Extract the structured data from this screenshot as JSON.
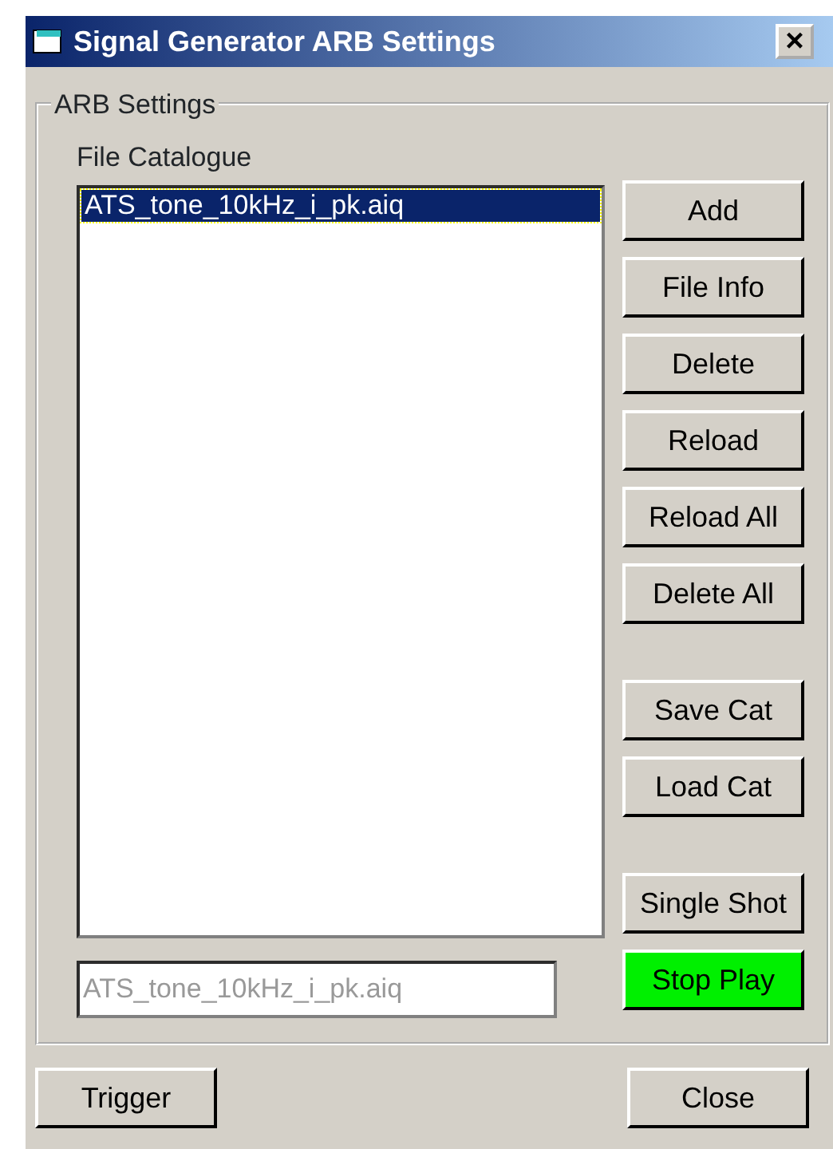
{
  "window": {
    "title": "Signal Generator ARB Settings",
    "close": "×"
  },
  "group": {
    "title": "ARB Settings",
    "list_label": "File Catalogue",
    "files": [
      {
        "name": "ATS_tone_10kHz_i_pk.aiq",
        "selected": true
      }
    ],
    "button_groups": [
      [
        {
          "label": "Add",
          "on": false
        },
        {
          "label": "File Info",
          "on": false
        },
        {
          "label": "Delete",
          "on": false
        },
        {
          "label": "Reload",
          "on": false
        },
        {
          "label": "Reload All",
          "on": false
        },
        {
          "label": "Delete All",
          "on": false
        }
      ],
      [
        {
          "label": "Save Cat",
          "on": false
        },
        {
          "label": "Load Cat",
          "on": false
        }
      ],
      [
        {
          "label": "Single Shot",
          "on": false
        },
        {
          "label": "Stop Play",
          "on": true
        }
      ]
    ],
    "file_field": {
      "value": "ATS_tone_10kHz_i_pk.aiq",
      "disabled": true
    }
  },
  "footer_buttons": [
    {
      "label": "Trigger"
    },
    {
      "label": "Close"
    }
  ]
}
